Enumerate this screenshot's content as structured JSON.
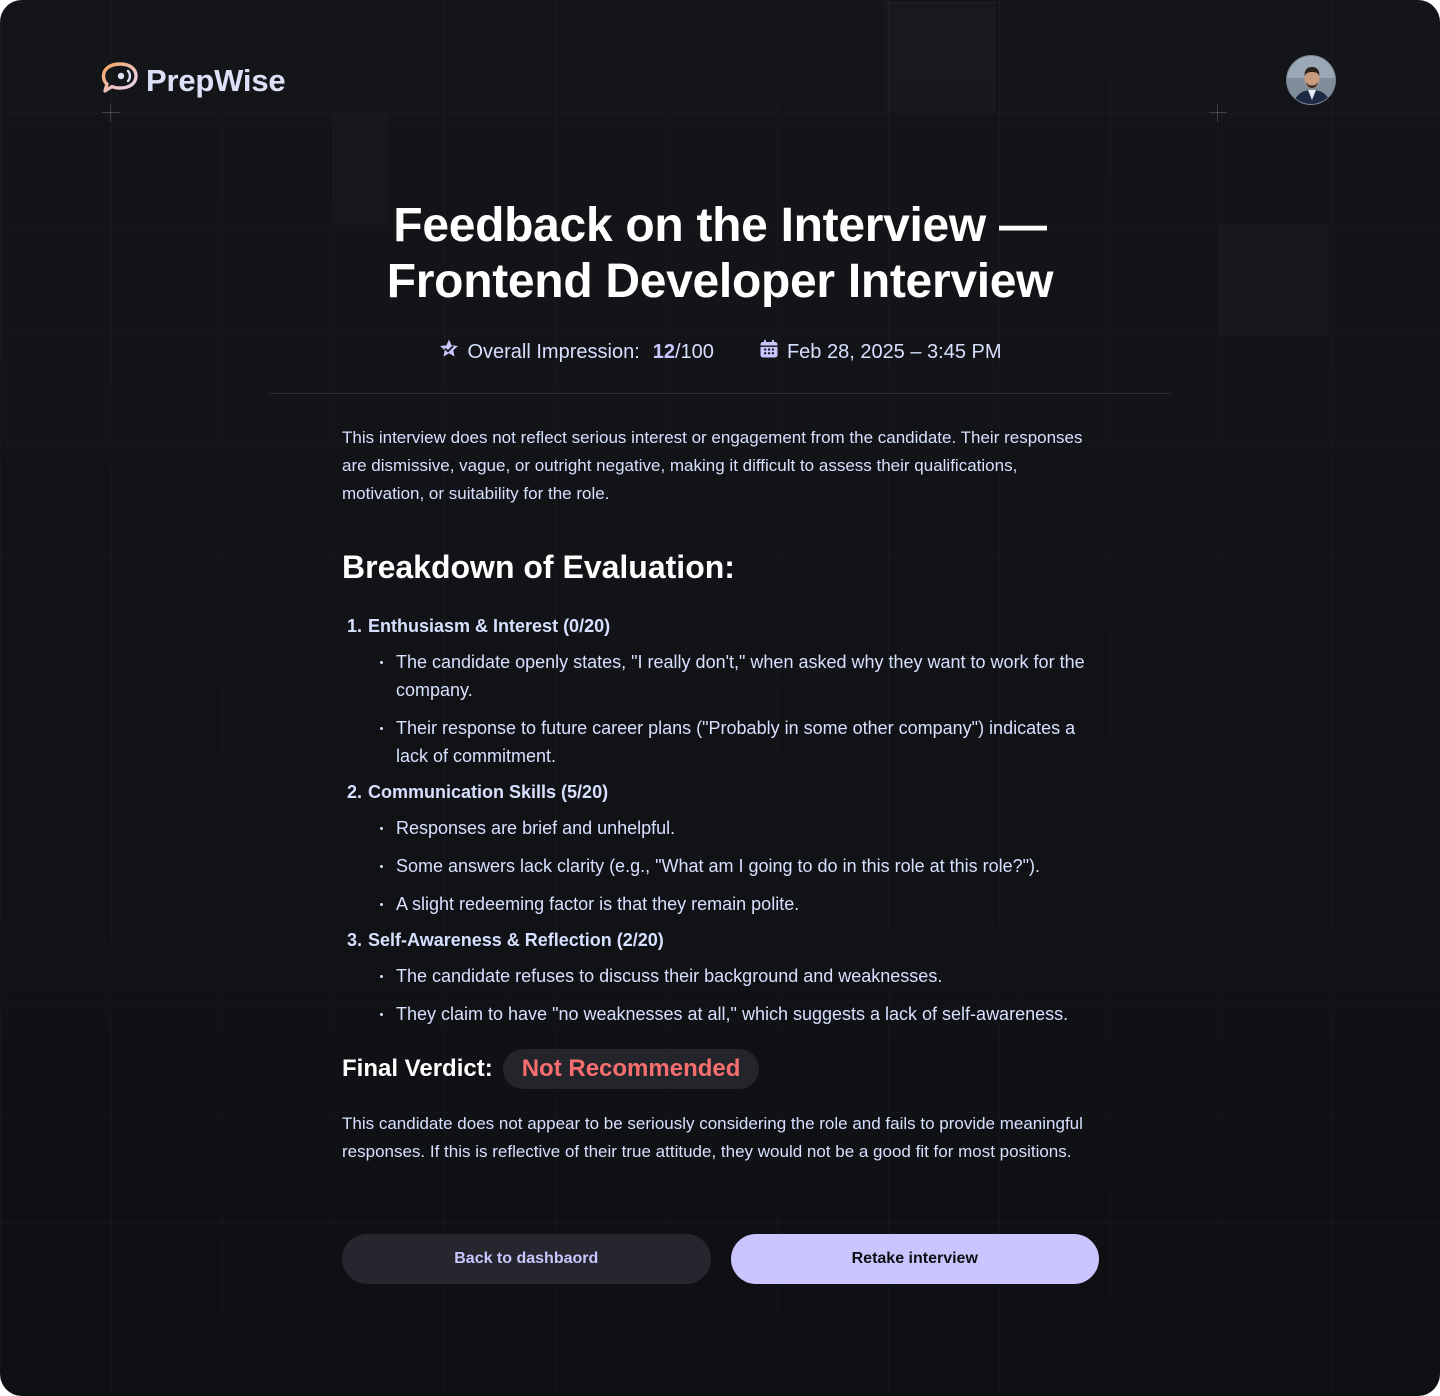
{
  "brand": {
    "name": "PrepWise"
  },
  "page": {
    "title_line1": "Feedback on the Interview —",
    "title_line2": "Frontend Developer Interview"
  },
  "meta": {
    "impression_label": "Overall Impression:",
    "score": "12",
    "score_total": "/100",
    "date": "Feb 28, 2025 – 3:45 PM"
  },
  "summary": "This interview does not reflect serious interest or engagement from the candidate. Their responses are dismissive, vague, or outright negative, making it difficult to assess their qualifications, motivation, or suitability for the role.",
  "breakdown": {
    "heading": "Breakdown of Evaluation:",
    "sections": [
      {
        "number": "1.",
        "title": "Enthusiasm & Interest (0/20)",
        "points": [
          "The candidate openly states, \"I really don't,\" when asked why they want to work for the company.",
          "Their response to future career plans (\"Probably in some other company\") indicates a lack of commitment."
        ]
      },
      {
        "number": "2.",
        "title": "Communication Skills (5/20)",
        "points": [
          "Responses are brief and unhelpful.",
          "Some answers lack clarity (e.g., \"What am I going to do in this role at this role?\").",
          "A slight redeeming factor is that they remain polite."
        ]
      },
      {
        "number": "3.",
        "title": "Self-Awareness & Reflection (2/20)",
        "points": [
          "The candidate refuses to discuss their background and weaknesses.",
          "They claim to have \"no weaknesses at all,\" which suggests a lack of self-awareness."
        ]
      }
    ]
  },
  "verdict": {
    "label": "Final Verdict:",
    "value": "Not Recommended",
    "color": "#f76e6e"
  },
  "conclusion": "This candidate does not appear to be seriously considering the role and fails to provide meaningful responses. If this is reflective of their true attitude, they would not be a good fit for most positions.",
  "actions": {
    "back_label": "Back to dashbaord",
    "retake_label": "Retake interview"
  },
  "colors": {
    "accent": "#cac5fe",
    "background": "#0f1014",
    "text": "#d6e0ff",
    "logo_orange": "#f5a35f"
  },
  "icons": {
    "logo": "chat-bubble-logo-icon",
    "impression": "star-badge-icon",
    "date": "calendar-icon"
  }
}
